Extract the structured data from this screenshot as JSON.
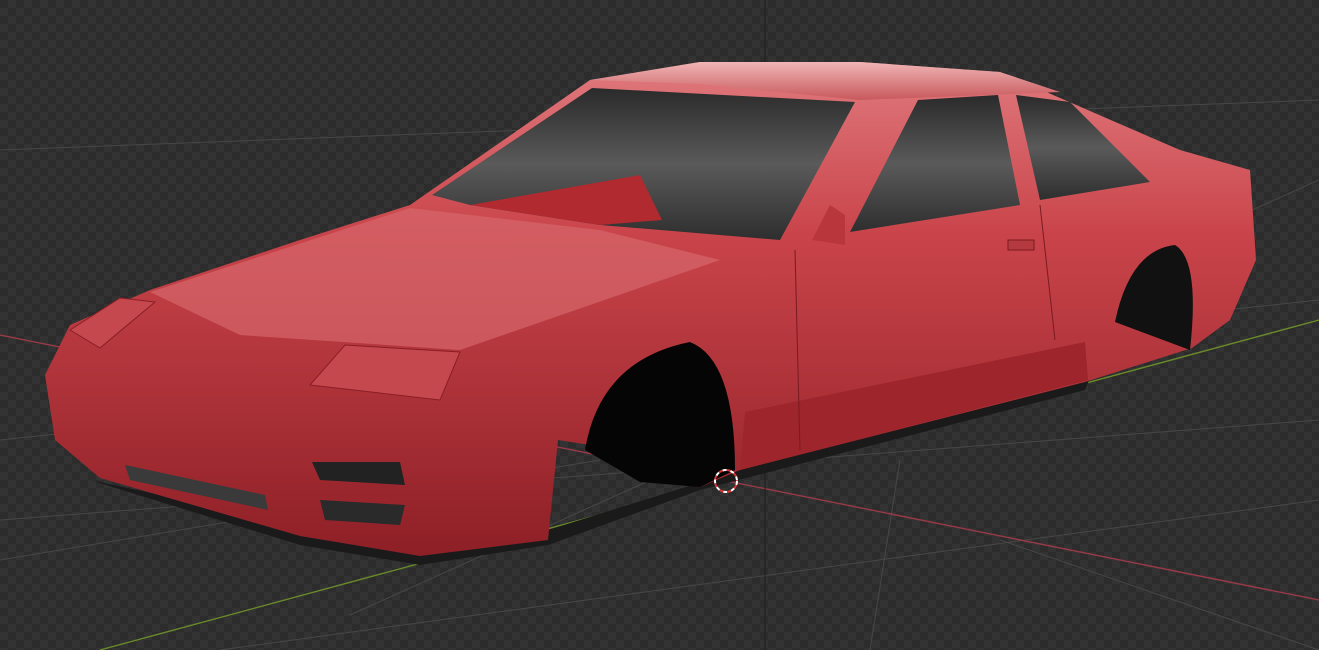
{
  "viewport": {
    "mode": "3D viewport",
    "colors": {
      "body": "#c23a40",
      "x_axis": "#9a3a48",
      "y_axis": "#6a8a2a",
      "grid": "#4a4a4a",
      "glass": "#3a3a3a"
    },
    "icons": [
      "3d-cursor-icon"
    ]
  }
}
